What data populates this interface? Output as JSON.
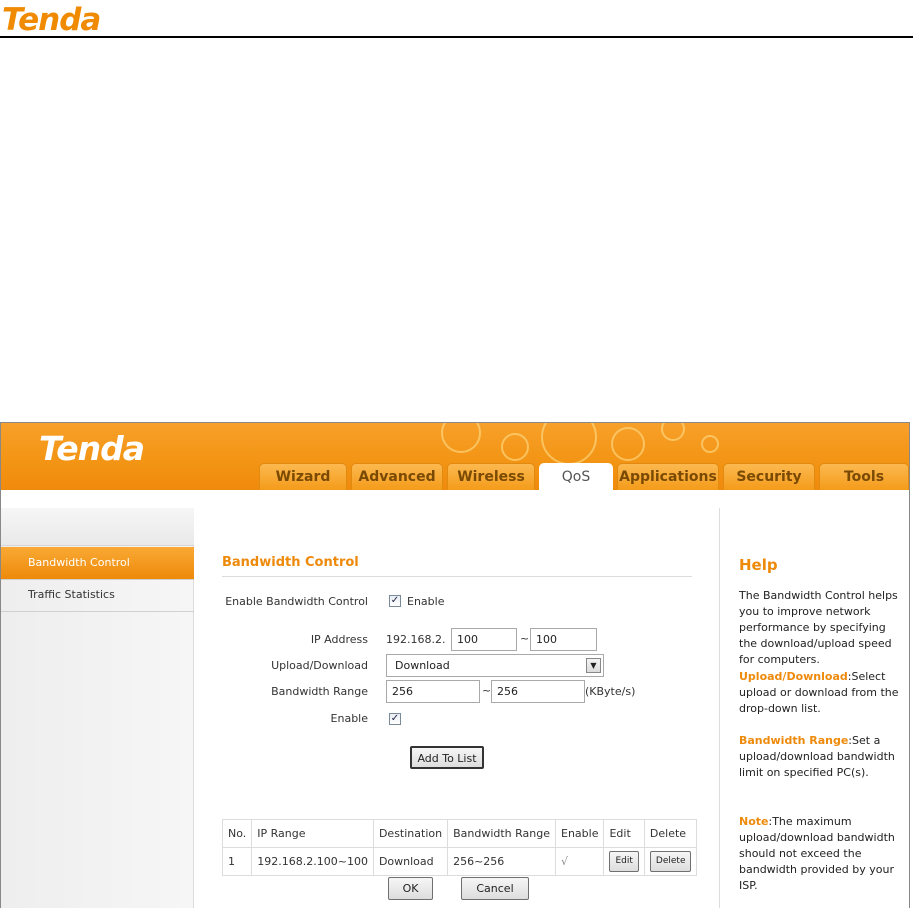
{
  "document": {
    "logo_text": "Tenda"
  },
  "app": {
    "logo_text": "Tenda",
    "accent_color": "#ee8a0b",
    "tabs": [
      {
        "label": "Wizard",
        "active": false
      },
      {
        "label": "Advanced",
        "active": false
      },
      {
        "label": "Wireless",
        "active": false
      },
      {
        "label": "QoS",
        "active": true
      },
      {
        "label": "Applications",
        "active": false
      },
      {
        "label": "Security",
        "active": false
      },
      {
        "label": "Tools",
        "active": false
      }
    ]
  },
  "sidebar": {
    "items": [
      {
        "label": "Bandwidth Control",
        "active": true
      },
      {
        "label": "Traffic Statistics",
        "active": false
      }
    ]
  },
  "main": {
    "title": "Bandwidth Control",
    "enable_bandwidth_label": "Enable Bandwidth Control",
    "enable_bandwidth_checked": true,
    "enable_bandwidth_text": "Enable",
    "ip_address_label": "IP Address",
    "ip_prefix": "192.168.2.",
    "ip_start": "100",
    "ip_tilde": "~",
    "ip_end": "100",
    "updown_label": "Upload/Download",
    "updown_value": "Download",
    "range_label": "Bandwidth Range",
    "range_start": "256",
    "range_tilde": "~",
    "range_end": "256",
    "range_unit": "(KByte/s)",
    "enable_label": "Enable",
    "enable_checked": true,
    "add_button": "Add To List",
    "table": {
      "headers": [
        "No.",
        "IP Range",
        "Destination",
        "Bandwidth Range",
        "Enable",
        "Edit",
        "Delete"
      ],
      "rows": [
        {
          "no": "1",
          "ip_range": "192.168.2.100~100",
          "destination": "Download",
          "bandwidth": "256~256",
          "enable": "√",
          "edit": "Edit",
          "delete": "Delete"
        }
      ]
    },
    "ok_button": "OK",
    "cancel_button": "Cancel"
  },
  "help": {
    "title": "Help",
    "intro": "The Bandwidth Control helps you to improve network performance by specifying the download/upload speed for computers.",
    "updown_term": "Upload/Download",
    "updown_desc": ":Select upload or download from the drop-down list.",
    "range_term": "Bandwidth Range",
    "range_desc": ":Set a upload/download bandwidth limit on specified PC(s).",
    "note_term": "Note",
    "note_desc": ":The maximum upload/download bandwidth should not exceed the bandwidth provided by your ISP."
  }
}
